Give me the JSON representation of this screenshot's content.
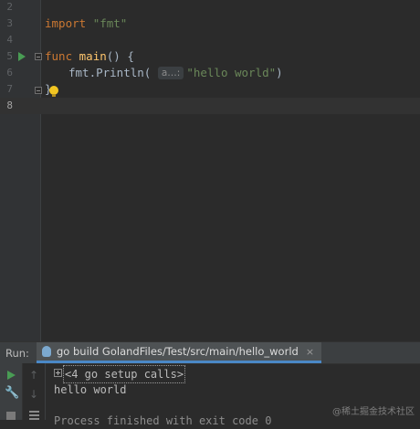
{
  "editor": {
    "lines": [
      {
        "num": "2"
      },
      {
        "num": "3",
        "import_kw": "import",
        "import_pkg": "\"fmt\""
      },
      {
        "num": "4"
      },
      {
        "num": "5",
        "func_kw": "func",
        "func_name": "main",
        "func_rest": "() {"
      },
      {
        "num": "6",
        "call": "fmt.Println(",
        "hint": "a…:",
        "arg": "\"hello world\"",
        "close": ")"
      },
      {
        "num": "7",
        "text": "}"
      },
      {
        "num": "8"
      }
    ]
  },
  "run_panel": {
    "label": "Run:",
    "tab_title": "go build GolandFiles/Test/src/main/hello_world",
    "close_symbol": "×",
    "console": {
      "setup_calls": "<4 go setup calls>",
      "output": "hello world",
      "truncated": "Process finished with exit code 0"
    }
  },
  "watermark": "@稀土掘金技术社区",
  "colors": {
    "run_green": "#499c54",
    "keyword": "#cc7832",
    "string": "#6a8759",
    "function": "#ffc66d",
    "tab_underline": "#4a88c7"
  }
}
